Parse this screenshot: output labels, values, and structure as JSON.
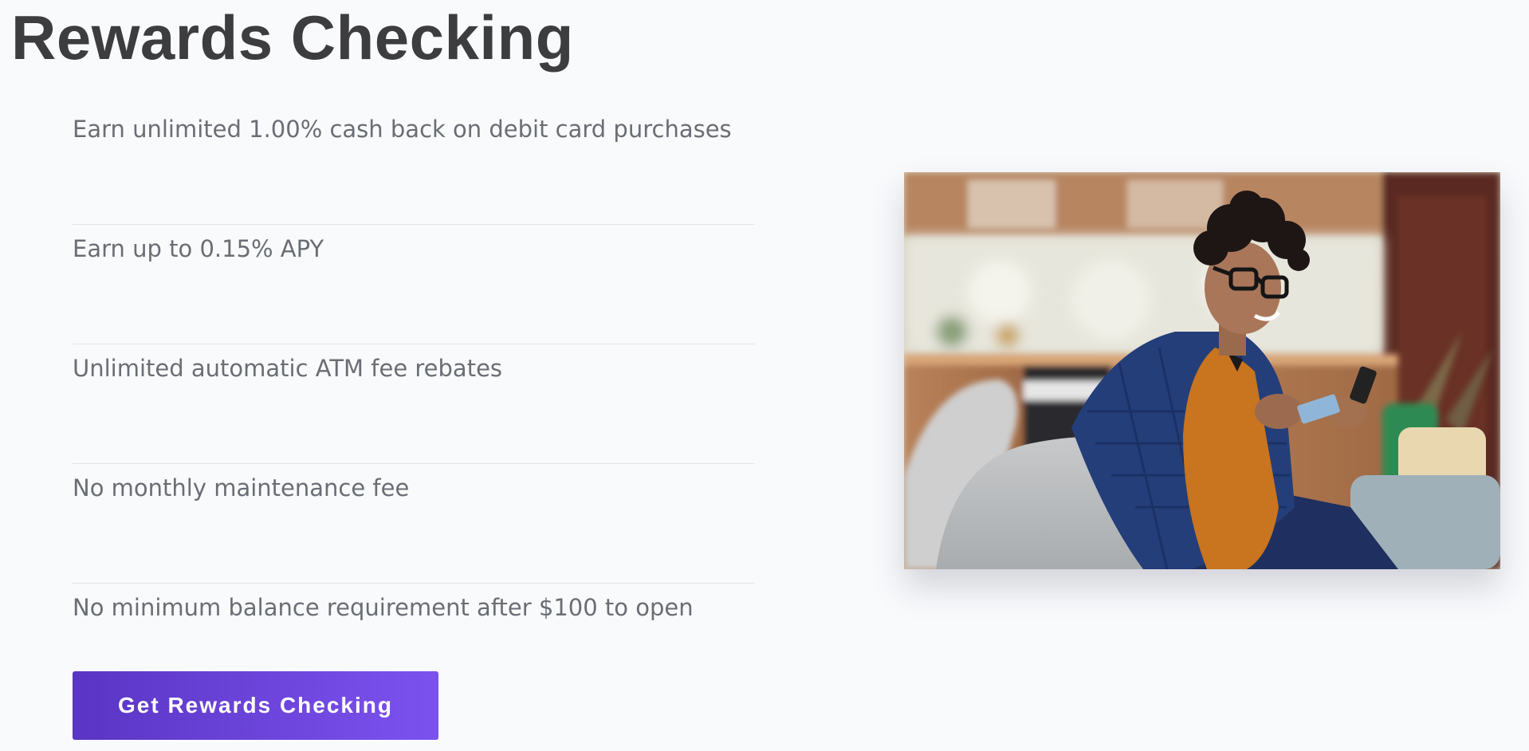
{
  "page": {
    "title": "Rewards Checking"
  },
  "features": [
    "Earn unlimited 1.00% cash back on debit card purchases",
    "Earn up to 0.15% APY",
    "Unlimited automatic ATM fee rebates",
    "No monthly maintenance fee",
    "No minimum balance requirement after $100 to open"
  ],
  "cta": {
    "label": "Get Rewards Checking",
    "gradient_start": "#5a35c4",
    "gradient_end": "#7c52ef"
  },
  "photo": {
    "icon": "smiling-man-with-phone-and-card-photo"
  },
  "colors": {
    "title": "#3d3d3f",
    "text": "#6a6e74",
    "background": "#f9fafc",
    "divider": "#e4e6ea"
  }
}
